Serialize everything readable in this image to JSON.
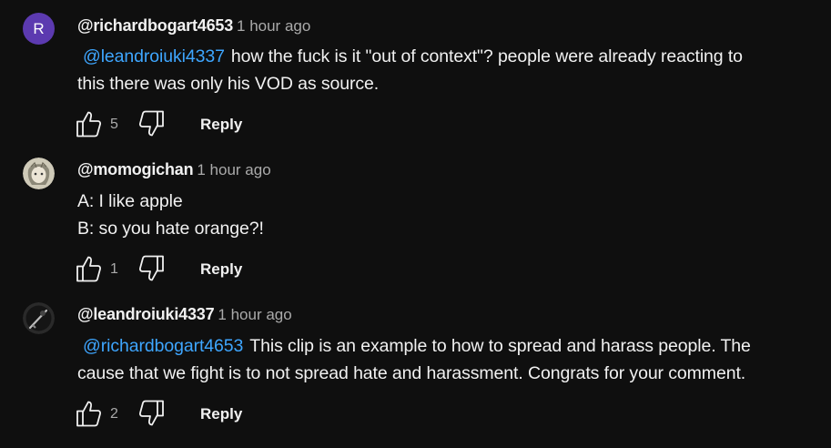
{
  "comments": [
    {
      "avatar_letter": "R",
      "avatar_color": "#5c3ab0",
      "username": "@richardbogart4653",
      "timestamp": "1 hour ago",
      "mention": "@leandroiuki4337",
      "text_first": "how the fuck is it \"out of context\"? people were already reacting to",
      "text_second": "this there was only his VOD as source.",
      "likes": "5",
      "reply_label": "Reply"
    },
    {
      "username": "@momogichan",
      "timestamp": "1 hour ago",
      "line1": "A: I like apple",
      "line2": "B: so you hate orange?!",
      "likes": "1",
      "reply_label": "Reply"
    },
    {
      "username": "@leandroiuki4337",
      "timestamp": "1 hour ago",
      "mention": "@richardbogart4653",
      "text_first": "This clip is an example to how to spread and harass people. The",
      "text_second": "cause that we fight is to not spread hate and harassment. Congrats for your comment.",
      "likes": "2",
      "reply_label": "Reply"
    }
  ],
  "icons": {
    "like": "thumbs-up-outline",
    "dislike": "thumbs-down-outline"
  },
  "colors": {
    "background": "#0f0f0f",
    "mention": "#3ea6ff",
    "secondary_text": "#aaaaaa"
  }
}
